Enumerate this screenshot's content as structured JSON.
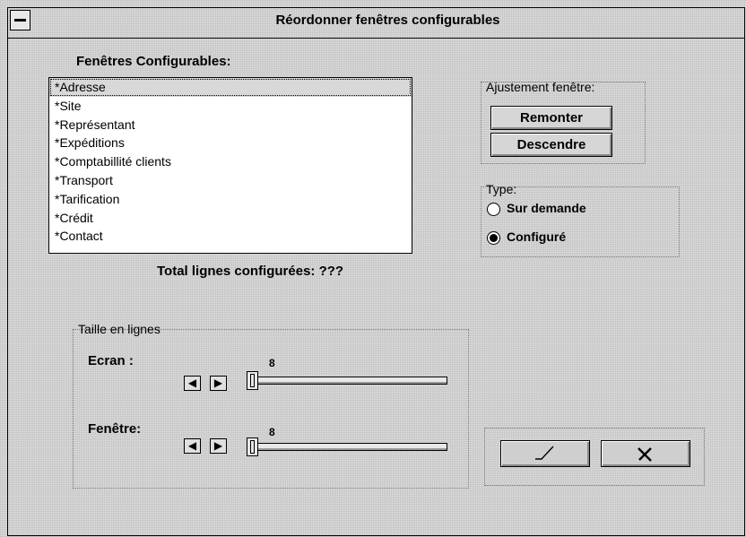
{
  "window": {
    "title": "Réordonner fenêtres configurables"
  },
  "list": {
    "label": "Fenêtres Configurables:",
    "items": [
      "*Adresse",
      "*Site",
      "*Représentant",
      "*Expéditions",
      "*Comptabillité clients",
      "*Transport",
      "*Tarification",
      "*Crédit",
      "*Contact"
    ],
    "selected_index": 0
  },
  "total": {
    "label": "Total lignes configurées: ???"
  },
  "adjust": {
    "label": "Ajustement fenêtre:",
    "up": "Remonter",
    "down": "Descendre"
  },
  "type": {
    "label": "Type:",
    "options": [
      "Sur demande",
      "Configuré"
    ],
    "selected": "Configuré"
  },
  "size": {
    "label": "Taille en lignes",
    "screen": {
      "label": "Ecran :",
      "value": "8"
    },
    "window": {
      "label": "Fenêtre:",
      "value": "8"
    }
  },
  "icons": {
    "ok": "checkmark-icon",
    "cancel": "x-icon",
    "left": "arrow-left-icon",
    "right": "arrow-right-icon"
  }
}
